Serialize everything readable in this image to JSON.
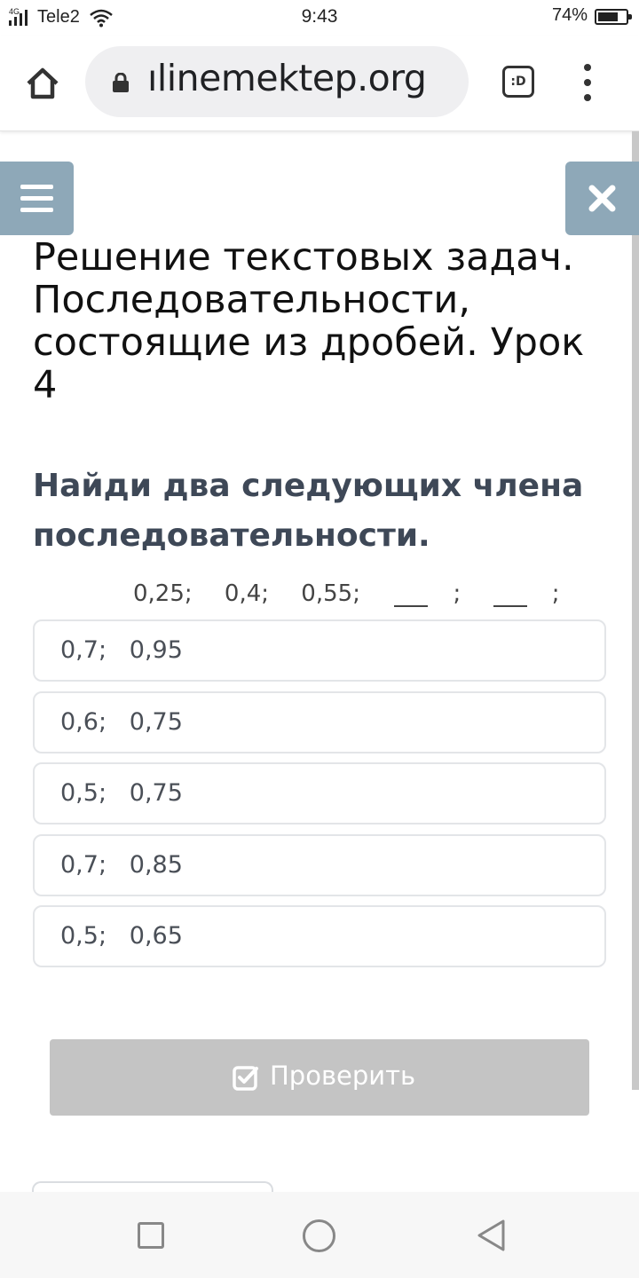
{
  "status_bar": {
    "network": "4G",
    "carrier": "Tele2",
    "time": "9:43",
    "battery_percent": "74%",
    "battery_level": 0.74
  },
  "browser": {
    "url": "ılinemektep.org",
    "tabs_label": ":D",
    "icons": [
      "home-icon",
      "lock-icon",
      "tab-switcher-icon",
      "overflow-menu-icon"
    ]
  },
  "page": {
    "title": "Решение текстовых задач. Последовательности, состоящие из дробей. Урок 4",
    "question": "Найди два следующих члена последовательности.",
    "sequence": {
      "terms": [
        "0,25;",
        "0,4;",
        "0,55;"
      ],
      "blank_separator": ";"
    },
    "options": [
      {
        "label": "0,7;   0,95"
      },
      {
        "label": "0,6;   0,75"
      },
      {
        "label": "0,5;   0,75"
      },
      {
        "label": "0,7;   0,85"
      },
      {
        "label": "0,5;   0,65"
      }
    ],
    "check_button": "Проверить",
    "accent_color": "#8ea8b8",
    "disabled_button_color": "#c4c4c4"
  },
  "nav_bar": {
    "icons": [
      "recents-icon",
      "home-circle-icon",
      "back-icon"
    ]
  }
}
